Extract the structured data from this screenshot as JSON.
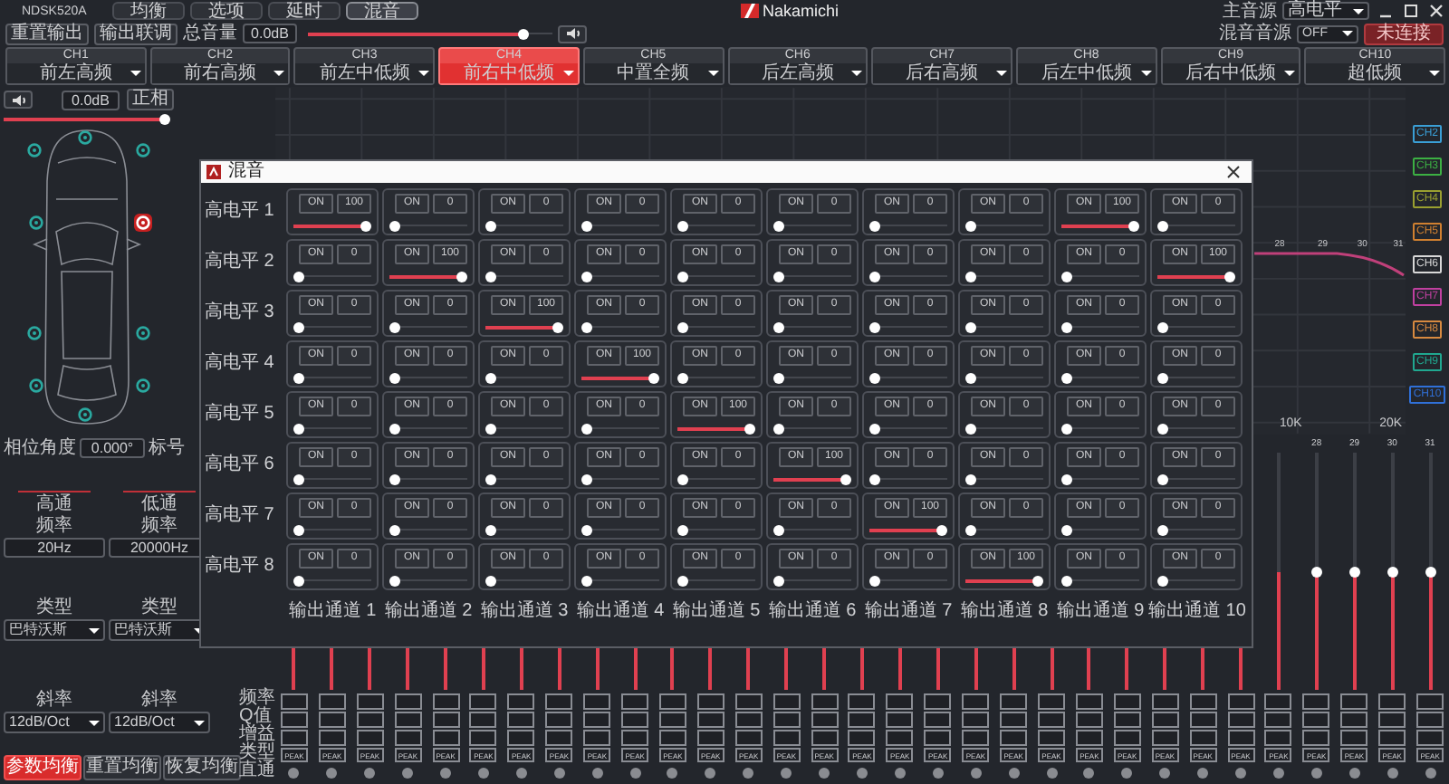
{
  "app": {
    "model": "NDSK520A",
    "nav_tabs": [
      {
        "label": "均衡",
        "selected": false
      },
      {
        "label": "选项",
        "selected": false
      },
      {
        "label": "延时",
        "selected": false
      },
      {
        "label": "混音",
        "selected": true
      }
    ],
    "logo": "Nakamichi",
    "source_label": "主音源",
    "source_value": "高电平"
  },
  "toolbar": {
    "buttons": [
      "重置输出",
      "输出联调"
    ],
    "volume": {
      "label": "总音量",
      "value": "0.0dB",
      "level": 0.9
    },
    "mix_source": {
      "label": "混音音源",
      "value": "OFF"
    },
    "connect_button": "未连接"
  },
  "channels": [
    {
      "name": "CH1",
      "label": "前左高频",
      "selected": false
    },
    {
      "name": "CH2",
      "label": "前右高频",
      "selected": false
    },
    {
      "name": "CH3",
      "label": "前左中低频",
      "selected": false
    },
    {
      "name": "CH4",
      "label": "前右中低频",
      "selected": true
    },
    {
      "name": "CH5",
      "label": "中置全频",
      "selected": false
    },
    {
      "name": "CH6",
      "label": "后左高频",
      "selected": false
    },
    {
      "name": "CH7",
      "label": "后右高频",
      "selected": false
    },
    {
      "name": "CH8",
      "label": "后左中低频",
      "selected": false
    },
    {
      "name": "CH9",
      "label": "后右中低频",
      "selected": false
    },
    {
      "name": "CH10",
      "label": "超低频",
      "selected": false
    }
  ],
  "left_panel": {
    "channel_value": "0.0dB",
    "phase_button": "正相",
    "level": 1,
    "phase_label": "相位角度",
    "phase_value": "0.000°",
    "tag_label": "标号",
    "speakers": [
      {
        "selected": false
      },
      {
        "selected": false
      },
      {
        "selected": false
      },
      {
        "selected": false
      },
      {
        "selected": true
      },
      {
        "selected": false
      },
      {
        "selected": false
      },
      {
        "selected": false
      },
      {
        "selected": false
      },
      {
        "selected": false
      }
    ],
    "filters": [
      {
        "title": "高通",
        "freq_label": "频率",
        "freq": "20Hz",
        "type_label": "类型",
        "type": "巴特沃斯",
        "slope_label": "斜率",
        "slope": "12dB/Oct"
      },
      {
        "title": "低通",
        "freq_label": "频率",
        "freq": "20000Hz",
        "type_label": "类型",
        "type": "巴特沃斯",
        "slope_label": "斜率",
        "slope": "12dB/Oct"
      }
    ],
    "eq_buttons": [
      {
        "label": "参数均衡",
        "selected": true
      },
      {
        "label": "重置均衡",
        "selected": false
      },
      {
        "label": "恢复均衡",
        "selected": false
      }
    ],
    "band_row_labels": [
      "频率",
      "Q值",
      "增益",
      "类型",
      "直通"
    ]
  },
  "graph": {
    "curve_labels": [
      "28",
      "29",
      "30",
      "31"
    ],
    "axis_labels": [
      "10K",
      "20K"
    ],
    "legend": [
      {
        "label": "CH2",
        "color": "#3a9fd6"
      },
      {
        "label": "CH3",
        "color": "#3cb043"
      },
      {
        "label": "CH4",
        "color": "#9aa030"
      },
      {
        "label": "CH5",
        "color": "#d08030"
      },
      {
        "label": "CH6",
        "color": "#d8d8d8"
      },
      {
        "label": "CH7",
        "color": "#c040a0"
      },
      {
        "label": "CH8",
        "color": "#d88a40"
      },
      {
        "label": "CH9",
        "color": "#20a890"
      },
      {
        "label": "CH10",
        "color": "#3070d8"
      }
    ]
  },
  "bands": [
    {
      "type": "PEAK",
      "level": 0.5
    },
    {
      "type": "PEAK",
      "level": 0.5
    },
    {
      "type": "PEAK",
      "level": 0.5
    },
    {
      "type": "PEAK",
      "level": 0.5
    },
    {
      "type": "PEAK",
      "level": 0.5
    },
    {
      "type": "PEAK",
      "level": 0.5
    },
    {
      "type": "PEAK",
      "level": 0.5
    },
    {
      "type": "PEAK",
      "level": 0.5
    },
    {
      "type": "PEAK",
      "level": 0.5
    },
    {
      "type": "PEAK",
      "level": 0.5
    },
    {
      "type": "PEAK",
      "level": 0.5
    },
    {
      "type": "PEAK",
      "level": 0.5
    },
    {
      "type": "PEAK",
      "level": 0.5
    },
    {
      "type": "PEAK",
      "level": 0.5
    },
    {
      "type": "PEAK",
      "level": 0.5
    },
    {
      "type": "PEAK",
      "level": 0.5
    },
    {
      "type": "PEAK",
      "level": 0.5
    },
    {
      "type": "PEAK",
      "level": 0.5
    },
    {
      "type": "PEAK",
      "level": 0.5
    },
    {
      "type": "PEAK",
      "level": 0.5
    },
    {
      "type": "PEAK",
      "level": 0.5
    },
    {
      "type": "PEAK",
      "level": 0.5
    },
    {
      "type": "PEAK",
      "level": 0.5
    },
    {
      "type": "PEAK",
      "level": 0.5
    },
    {
      "type": "PEAK",
      "level": 0.5
    },
    {
      "type": "PEAK",
      "level": 0.5
    },
    {
      "type": "PEAK",
      "level": 0.5
    },
    {
      "number": "28",
      "type": "PEAK",
      "level": 0.5
    },
    {
      "number": "29",
      "type": "PEAK",
      "level": 0.5
    },
    {
      "number": "30",
      "type": "PEAK",
      "level": 0.5
    },
    {
      "number": "31",
      "type": "PEAK",
      "level": 0.5
    }
  ],
  "mixer": {
    "title": "混音",
    "rows": [
      {
        "label": "高电平 1",
        "cells": [
          {
            "button": "ON",
            "value": "100",
            "level": 1
          },
          {
            "button": "ON",
            "value": "0",
            "level": 0
          },
          {
            "button": "ON",
            "value": "0",
            "level": 0
          },
          {
            "button": "ON",
            "value": "0",
            "level": 0
          },
          {
            "button": "ON",
            "value": "0",
            "level": 0
          },
          {
            "button": "ON",
            "value": "0",
            "level": 0
          },
          {
            "button": "ON",
            "value": "0",
            "level": 0
          },
          {
            "button": "ON",
            "value": "0",
            "level": 0
          },
          {
            "button": "ON",
            "value": "100",
            "level": 1
          },
          {
            "button": "ON",
            "value": "0",
            "level": 0
          }
        ]
      },
      {
        "label": "高电平 2",
        "cells": [
          {
            "button": "ON",
            "value": "0",
            "level": 0
          },
          {
            "button": "ON",
            "value": "100",
            "level": 1
          },
          {
            "button": "ON",
            "value": "0",
            "level": 0
          },
          {
            "button": "ON",
            "value": "0",
            "level": 0
          },
          {
            "button": "ON",
            "value": "0",
            "level": 0
          },
          {
            "button": "ON",
            "value": "0",
            "level": 0
          },
          {
            "button": "ON",
            "value": "0",
            "level": 0
          },
          {
            "button": "ON",
            "value": "0",
            "level": 0
          },
          {
            "button": "ON",
            "value": "0",
            "level": 0
          },
          {
            "button": "ON",
            "value": "100",
            "level": 1
          }
        ]
      },
      {
        "label": "高电平 3",
        "cells": [
          {
            "button": "ON",
            "value": "0",
            "level": 0
          },
          {
            "button": "ON",
            "value": "0",
            "level": 0
          },
          {
            "button": "ON",
            "value": "100",
            "level": 1
          },
          {
            "button": "ON",
            "value": "0",
            "level": 0
          },
          {
            "button": "ON",
            "value": "0",
            "level": 0
          },
          {
            "button": "ON",
            "value": "0",
            "level": 0
          },
          {
            "button": "ON",
            "value": "0",
            "level": 0
          },
          {
            "button": "ON",
            "value": "0",
            "level": 0
          },
          {
            "button": "ON",
            "value": "0",
            "level": 0
          },
          {
            "button": "ON",
            "value": "0",
            "level": 0
          }
        ]
      },
      {
        "label": "高电平 4",
        "cells": [
          {
            "button": "ON",
            "value": "0",
            "level": 0
          },
          {
            "button": "ON",
            "value": "0",
            "level": 0
          },
          {
            "button": "ON",
            "value": "0",
            "level": 0
          },
          {
            "button": "ON",
            "value": "100",
            "level": 1
          },
          {
            "button": "ON",
            "value": "0",
            "level": 0
          },
          {
            "button": "ON",
            "value": "0",
            "level": 0
          },
          {
            "button": "ON",
            "value": "0",
            "level": 0
          },
          {
            "button": "ON",
            "value": "0",
            "level": 0
          },
          {
            "button": "ON",
            "value": "0",
            "level": 0
          },
          {
            "button": "ON",
            "value": "0",
            "level": 0
          }
        ]
      },
      {
        "label": "高电平 5",
        "cells": [
          {
            "button": "ON",
            "value": "0",
            "level": 0
          },
          {
            "button": "ON",
            "value": "0",
            "level": 0
          },
          {
            "button": "ON",
            "value": "0",
            "level": 0
          },
          {
            "button": "ON",
            "value": "0",
            "level": 0
          },
          {
            "button": "ON",
            "value": "100",
            "level": 1
          },
          {
            "button": "ON",
            "value": "0",
            "level": 0
          },
          {
            "button": "ON",
            "value": "0",
            "level": 0
          },
          {
            "button": "ON",
            "value": "0",
            "level": 0
          },
          {
            "button": "ON",
            "value": "0",
            "level": 0
          },
          {
            "button": "ON",
            "value": "0",
            "level": 0
          }
        ]
      },
      {
        "label": "高电平 6",
        "cells": [
          {
            "button": "ON",
            "value": "0",
            "level": 0
          },
          {
            "button": "ON",
            "value": "0",
            "level": 0
          },
          {
            "button": "ON",
            "value": "0",
            "level": 0
          },
          {
            "button": "ON",
            "value": "0",
            "level": 0
          },
          {
            "button": "ON",
            "value": "0",
            "level": 0
          },
          {
            "button": "ON",
            "value": "100",
            "level": 1
          },
          {
            "button": "ON",
            "value": "0",
            "level": 0
          },
          {
            "button": "ON",
            "value": "0",
            "level": 0
          },
          {
            "button": "ON",
            "value": "0",
            "level": 0
          },
          {
            "button": "ON",
            "value": "0",
            "level": 0
          }
        ]
      },
      {
        "label": "高电平 7",
        "cells": [
          {
            "button": "ON",
            "value": "0",
            "level": 0
          },
          {
            "button": "ON",
            "value": "0",
            "level": 0
          },
          {
            "button": "ON",
            "value": "0",
            "level": 0
          },
          {
            "button": "ON",
            "value": "0",
            "level": 0
          },
          {
            "button": "ON",
            "value": "0",
            "level": 0
          },
          {
            "button": "ON",
            "value": "0",
            "level": 0
          },
          {
            "button": "ON",
            "value": "100",
            "level": 1
          },
          {
            "button": "ON",
            "value": "0",
            "level": 0
          },
          {
            "button": "ON",
            "value": "0",
            "level": 0
          },
          {
            "button": "ON",
            "value": "0",
            "level": 0
          }
        ]
      },
      {
        "label": "高电平 8",
        "cells": [
          {
            "button": "ON",
            "value": "0",
            "level": 0
          },
          {
            "button": "ON",
            "value": "0",
            "level": 0
          },
          {
            "button": "ON",
            "value": "0",
            "level": 0
          },
          {
            "button": "ON",
            "value": "0",
            "level": 0
          },
          {
            "button": "ON",
            "value": "0",
            "level": 0
          },
          {
            "button": "ON",
            "value": "0",
            "level": 0
          },
          {
            "button": "ON",
            "value": "0",
            "level": 0
          },
          {
            "button": "ON",
            "value": "100",
            "level": 1
          },
          {
            "button": "ON",
            "value": "0",
            "level": 0
          },
          {
            "button": "ON",
            "value": "0",
            "level": 0
          }
        ]
      }
    ],
    "footer_labels": [
      "输出通道 1",
      "输出通道 2",
      "输出通道 3",
      "输出通道 4",
      "输出通道 5",
      "输出通道 6",
      "输出通道 7",
      "输出通道 8",
      "输出通道 9",
      "输出通道 10"
    ]
  }
}
